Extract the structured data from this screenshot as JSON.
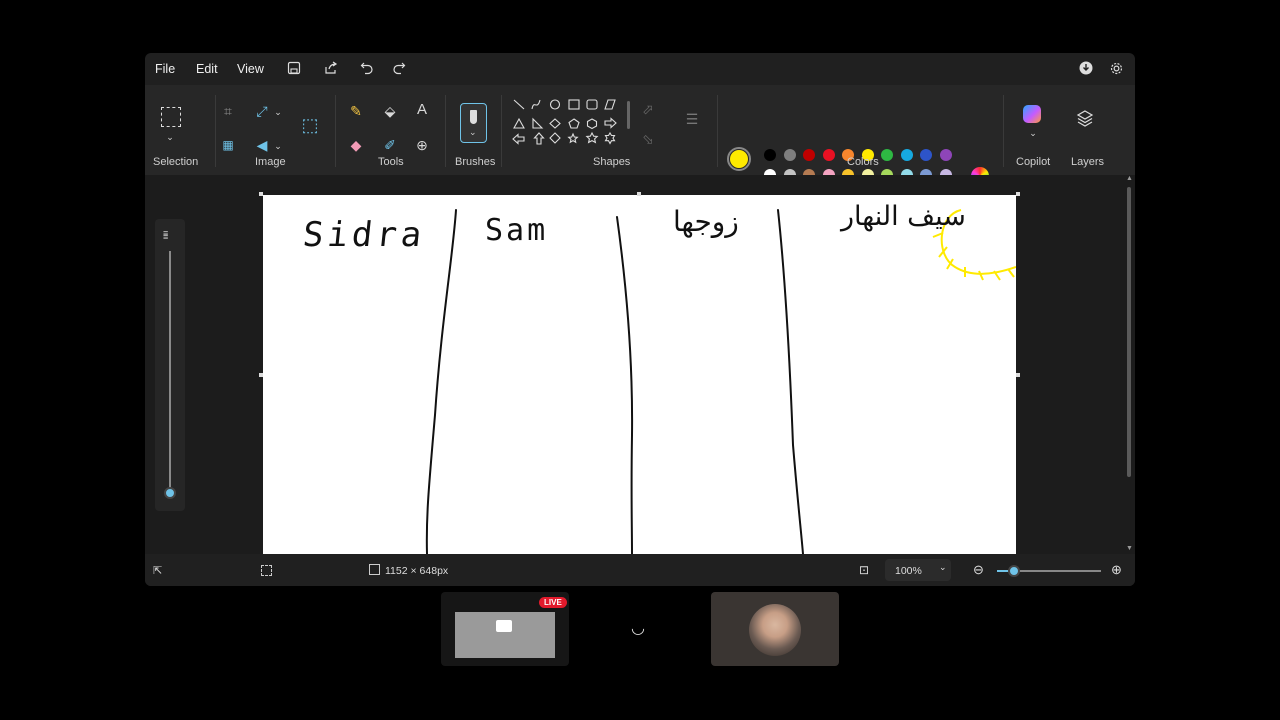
{
  "menu": {
    "file": "File",
    "edit": "Edit",
    "view": "View"
  },
  "ribbon": {
    "selection": "Selection",
    "image": "Image",
    "tools": "Tools",
    "brushes": "Brushes",
    "shapes": "Shapes",
    "colors": "Colors",
    "copilot": "Copilot",
    "layers": "Layers"
  },
  "colors": {
    "primary": "#ffea00",
    "secondary": "#ffffff",
    "row1": [
      "#000000",
      "#7f7f7f",
      "#c00000",
      "#e81123",
      "#f7862d",
      "#ffea00",
      "#2eb843",
      "#16a9e0",
      "#2d54c9",
      "#8e45b8"
    ],
    "row2": [
      "#ffffff",
      "#c3c3c3",
      "#b57b52",
      "#f4a3c1",
      "#f8c22a",
      "#f3f1a0",
      "#a6d95d",
      "#92dbe9",
      "#7c9ad3",
      "#c7b7e3"
    ]
  },
  "canvas": {
    "labels": [
      "Sidra",
      "Sam",
      "زوجها",
      "سيف النهار"
    ],
    "sun_color": "#ffea00"
  },
  "status": {
    "canvas_size": "1152 × 648px",
    "zoom": "100%"
  },
  "stream": {
    "live_badge": "LIVE"
  }
}
